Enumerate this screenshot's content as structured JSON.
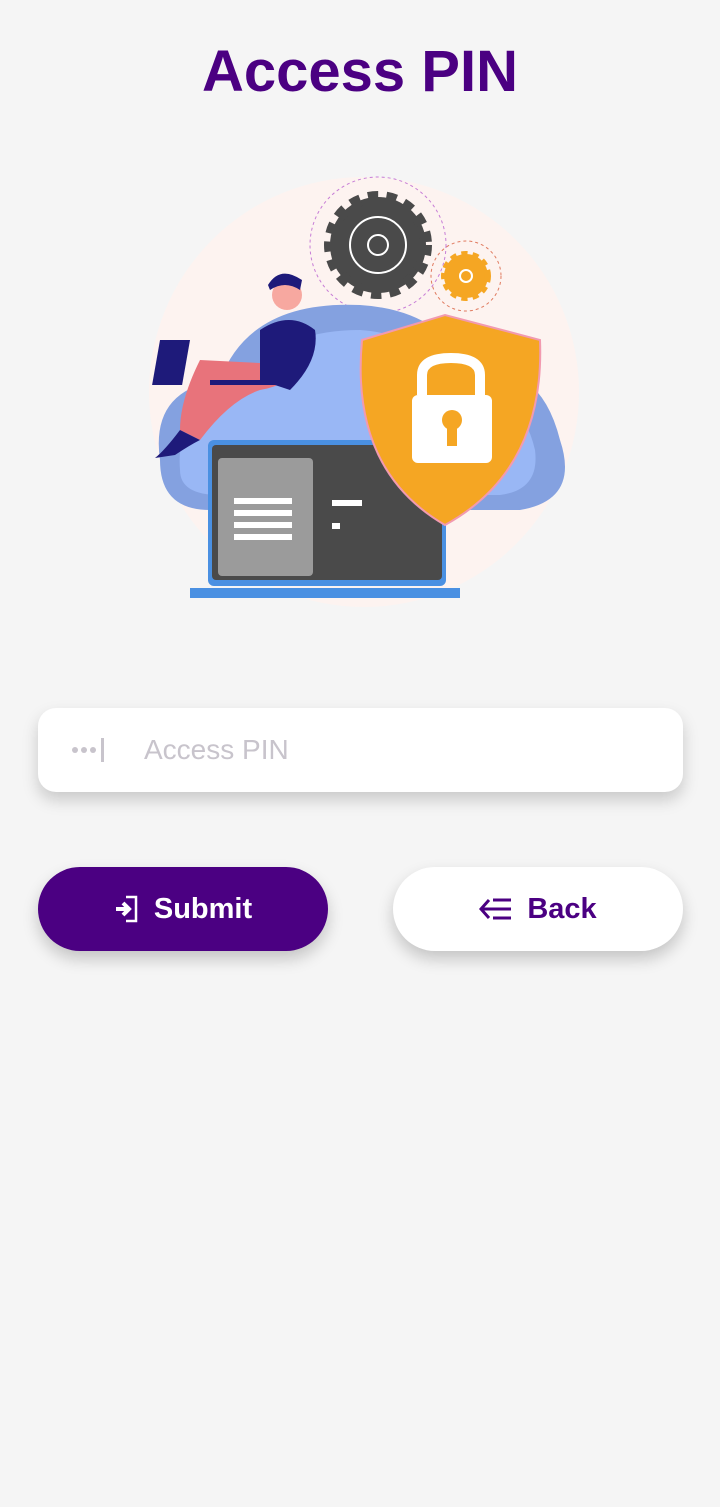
{
  "page": {
    "title": "Access PIN"
  },
  "illustration": {
    "name": "security-lock-illustration"
  },
  "form": {
    "pin_placeholder": "Access PIN",
    "pin_value": "",
    "pin_icon": "password-dots-icon"
  },
  "buttons": {
    "submit_label": "Submit",
    "submit_icon": "login-icon",
    "back_label": "Back",
    "back_icon": "back-list-icon"
  },
  "colors": {
    "primary": "#4b0082",
    "background": "#f5f5f5",
    "shield": "#f5a623"
  }
}
